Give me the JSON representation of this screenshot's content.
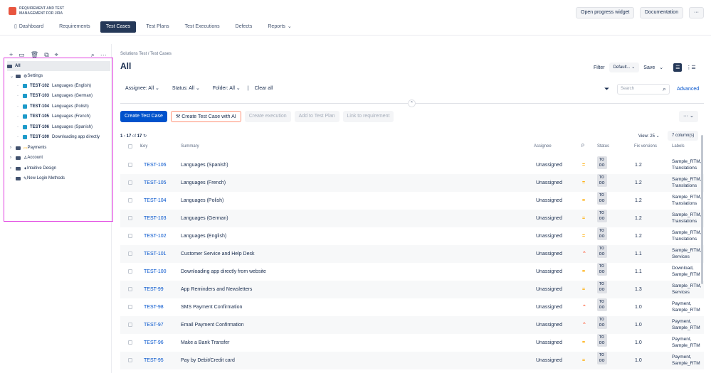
{
  "app": {
    "logo_text_line1": "REQUIREMENT AND TEST",
    "logo_text_line2": "MANAGEMENT FOR JIRA",
    "open_progress": "Open progress widget",
    "documentation": "Documentation",
    "more": "···"
  },
  "nav": [
    "Dashboard",
    "Requirements",
    "Test Cases",
    "Test Plans",
    "Test Executions",
    "Defects",
    "Reports"
  ],
  "tree": [
    {
      "label": "All"
    },
    {
      "label": "Settings"
    },
    {
      "key": "TEST-102",
      "label": "Languages (English)"
    },
    {
      "key": "TEST-103",
      "label": "Languages (German)"
    },
    {
      "key": "TEST-104",
      "label": "Languages (Polish)"
    },
    {
      "key": "TEST-105",
      "label": "Languages (French)"
    },
    {
      "key": "TEST-106",
      "label": "Languages (Spanish)"
    },
    {
      "key": "TEST-100",
      "label": "Downloading app directly"
    },
    {
      "label": "Payments"
    },
    {
      "label": "Account"
    },
    {
      "label": "Intuitive Design"
    },
    {
      "label": "New Login Methods"
    }
  ],
  "main": {
    "crumb1": "Solutions Test",
    "crumb_sep": "/",
    "crumb2": "Test Cases",
    "title": "All",
    "filter": "Filter",
    "filter_value": "Default...",
    "save": "Save",
    "assignee": "Assignee: All",
    "status": "Status: All",
    "folder": "Folder: All",
    "clear": "Clear all",
    "search_placeholder": "Search",
    "advanced": "Advanced",
    "btn_create": "Create Test Case",
    "btn_ai": "Create Test Case with AI",
    "btn_exec": "Create execution",
    "btn_plan": "Add to Test Plan",
    "btn_link": "Link to requirement",
    "btn_more": "···",
    "count_range": "1 - 17",
    "count_of": "of",
    "count_total": "17",
    "view": "View: 25",
    "columns": "7 column(s)"
  },
  "headers": {
    "key": "Key",
    "summary": "Summary",
    "assignee": "Assignee",
    "p": "P",
    "status": "Status",
    "fix": "Fix versions",
    "labels": "Labels"
  },
  "rows": [
    {
      "key": "TEST-106",
      "summary": "Languages (Spanish)",
      "assignee": "Unassigned",
      "priority": "medium",
      "status": "TO DO",
      "fix": "1.2",
      "l1": "Sample_RTM,",
      "l2": "Translations"
    },
    {
      "key": "TEST-105",
      "summary": "Languages (French)",
      "assignee": "Unassigned",
      "priority": "medium",
      "status": "TO DO",
      "fix": "1.2",
      "l1": "Sample_RTM,",
      "l2": "Translations"
    },
    {
      "key": "TEST-104",
      "summary": "Languages (Polish)",
      "assignee": "Unassigned",
      "priority": "medium",
      "status": "TO DO",
      "fix": "1.2",
      "l1": "Sample_RTM,",
      "l2": "Translations"
    },
    {
      "key": "TEST-103",
      "summary": "Languages (German)",
      "assignee": "Unassigned",
      "priority": "medium",
      "status": "TO DO",
      "fix": "1.2",
      "l1": "Sample_RTM,",
      "l2": "Translations"
    },
    {
      "key": "TEST-102",
      "summary": "Languages (English)",
      "assignee": "Unassigned",
      "priority": "medium",
      "status": "TO DO",
      "fix": "1.2",
      "l1": "Sample_RTM,",
      "l2": "Translations"
    },
    {
      "key": "TEST-101",
      "summary": "Customer Service and Help Desk",
      "assignee": "Unassigned",
      "priority": "high",
      "status": "TO DO",
      "fix": "1.1",
      "l1": "Sample_RTM,",
      "l2": "Services"
    },
    {
      "key": "TEST-100",
      "summary": "Downloading app directly from website",
      "assignee": "Unassigned",
      "priority": "medium",
      "status": "TO DO",
      "fix": "1.1",
      "l1": "Download,",
      "l2": "Sample_RTM"
    },
    {
      "key": "TEST-99",
      "summary": "App Reminders and Newsletters",
      "assignee": "Unassigned",
      "priority": "medium",
      "status": "TO DO",
      "fix": "1.3",
      "l1": "Sample_RTM,",
      "l2": "Services"
    },
    {
      "key": "TEST-98",
      "summary": "SMS Payment Confirmation",
      "assignee": "Unassigned",
      "priority": "high",
      "status": "TO DO",
      "fix": "1.0",
      "l1": "Payment,",
      "l2": "Sample_RTM"
    },
    {
      "key": "TEST-97",
      "summary": "Email Payment Confirmation",
      "assignee": "Unassigned",
      "priority": "high",
      "status": "TO DO",
      "fix": "1.0",
      "l1": "Payment,",
      "l2": "Sample_RTM"
    },
    {
      "key": "TEST-96",
      "summary": "Make a Bank Transfer",
      "assignee": "Unassigned",
      "priority": "medium",
      "status": "TO DO",
      "fix": "1.0",
      "l1": "Payment,",
      "l2": "Sample_RTM"
    },
    {
      "key": "TEST-95",
      "summary": "Pay by Debit/Credit card",
      "assignee": "Unassigned",
      "priority": "medium",
      "status": "TO DO",
      "fix": "1.0",
      "l1": "Payment,",
      "l2": "Sample_RTM"
    }
  ]
}
